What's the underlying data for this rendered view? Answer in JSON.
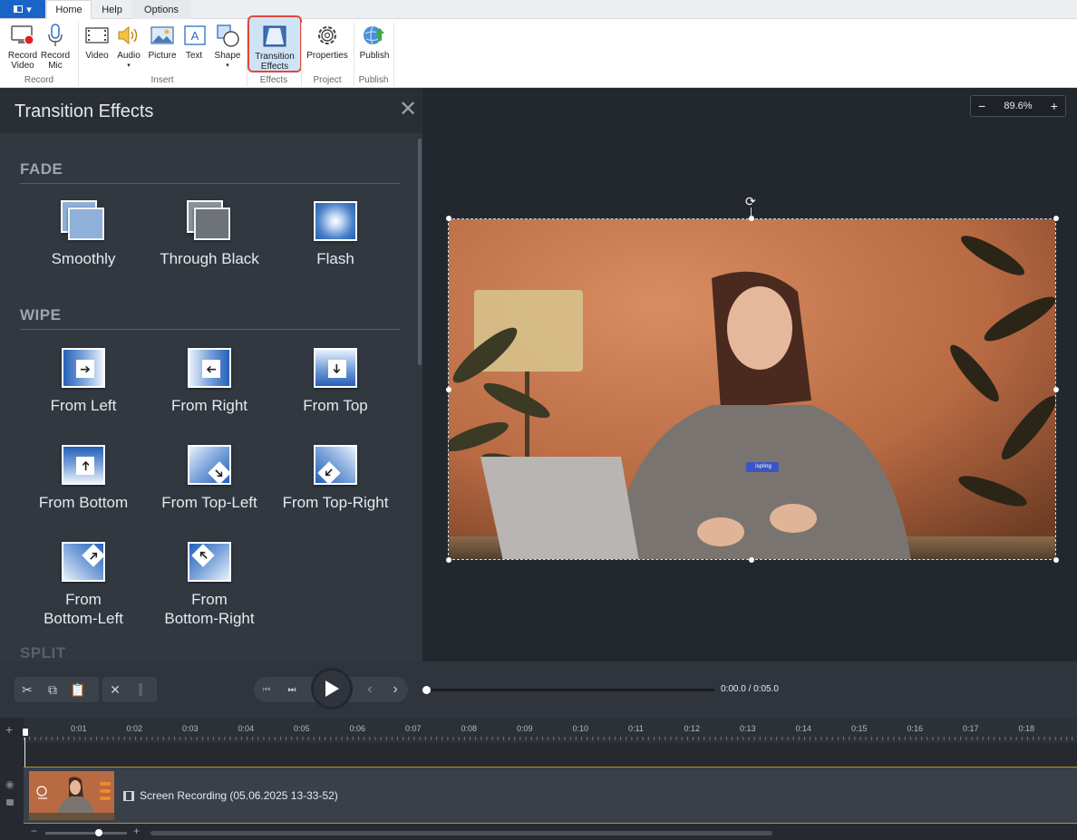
{
  "app_menu": {
    "icon": "app-menu-icon",
    "caret": "▾"
  },
  "tabs": [
    {
      "label": "Home",
      "active": true
    },
    {
      "label": "Help",
      "active": false
    },
    {
      "label": "Options",
      "active": false
    }
  ],
  "ribbon": {
    "record_video": "Record\nVideo",
    "record_mic": "Record\nMic",
    "video": "Video",
    "audio": "Audio",
    "picture": "Picture",
    "text": "Text",
    "shape": "Shape",
    "transition_effects": "Transition\nEffects",
    "properties": "Properties",
    "publish": "Publish",
    "groups": {
      "record": "Record",
      "insert": "Insert",
      "effects": "Effects",
      "project": "Project",
      "publish": "Publish"
    }
  },
  "panel": {
    "title": "Transition Effects",
    "close": "✕",
    "sections": {
      "fade": "FADE",
      "wipe": "WIPE",
      "split": "SPLIT"
    },
    "fade_effects": [
      "Smoothly",
      "Through Black",
      "Flash"
    ],
    "wipe_effects": [
      "From Left",
      "From Right",
      "From Top",
      "From Bottom",
      "From Top-Left",
      "From Top-Right",
      "From\nBottom-Left",
      "From\nBottom-Right"
    ]
  },
  "canvas": {
    "zoom_minus": "−",
    "zoom_value": "89.6%",
    "zoom_plus": "+",
    "badge_text": "ispring"
  },
  "player": {
    "time": "0:00.0 / 0:05.0"
  },
  "timeline": {
    "add": "+",
    "ticks": [
      "0:01",
      "0:02",
      "0:03",
      "0:04",
      "0:05",
      "0:06",
      "0:07",
      "0:08",
      "0:09",
      "0:10",
      "0:11",
      "0:12",
      "0:13",
      "0:14",
      "0:15",
      "0:16",
      "0:17",
      "0:18"
    ],
    "clip_label": "Screen Recording (05.06.2025 13-33-52)",
    "zoom_minus": "−",
    "zoom_plus": "+"
  },
  "colors": {
    "accent": "#1a64c8",
    "highlight_border": "#e0473b",
    "panel_bg": "#323840",
    "clip_border": "#b98e2f"
  }
}
